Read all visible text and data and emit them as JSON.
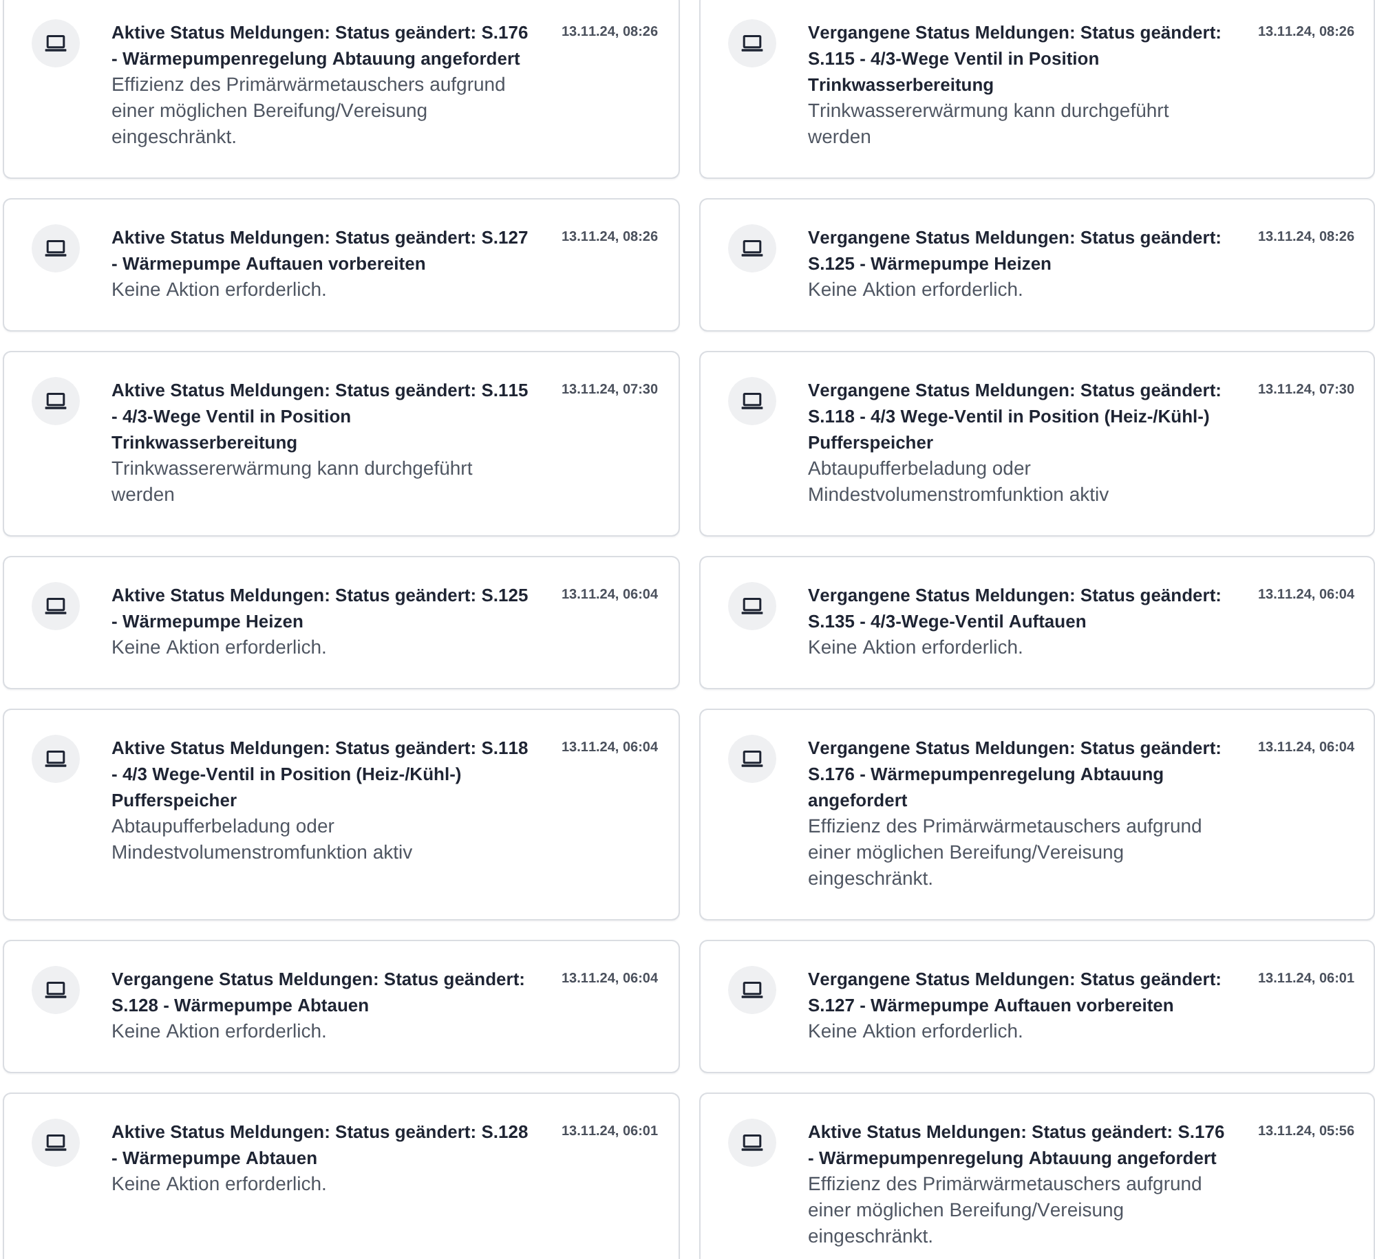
{
  "notifications": [
    {
      "title": "Aktive Status Meldungen: Status geändert: S.176 - Wärmepumpenregelung Abtauung angefordert",
      "timestamp": "13.11.24, 08:26",
      "message": "Effizienz des Primärwärmetauschers aufgrund einer möglichen Bereifung/Vereisung eingeschränkt."
    },
    {
      "title": "Vergangene Status Meldungen: Status geändert: S.115 - 4/3-Wege Ventil in Position Trinkwasserbereitung",
      "timestamp": "13.11.24, 08:26",
      "message": "Trinkwassererwärmung kann durchgeführt werden"
    },
    {
      "title": "Aktive Status Meldungen: Status geändert: S.127 - Wärmepumpe Auftauen vorbereiten",
      "timestamp": "13.11.24, 08:26",
      "message": "Keine Aktion erforderlich."
    },
    {
      "title": "Vergangene Status Meldungen: Status geändert: S.125 - Wärmepumpe Heizen",
      "timestamp": "13.11.24, 08:26",
      "message": "Keine Aktion erforderlich."
    },
    {
      "title": "Aktive Status Meldungen: Status geändert: S.115 - 4/3-Wege Ventil in Position Trinkwasserbereitung",
      "timestamp": "13.11.24, 07:30",
      "message": "Trinkwassererwärmung kann durchgeführt werden"
    },
    {
      "title": "Vergangene Status Meldungen: Status geändert: S.118 - 4/3 Wege-Ventil in Position (Heiz-/Kühl-) Pufferspeicher",
      "timestamp": "13.11.24, 07:30",
      "message": "Abtaupufferbeladung oder Mindestvolumenstromfunktion aktiv"
    },
    {
      "title": "Aktive Status Meldungen: Status geändert: S.125 - Wärmepumpe Heizen",
      "timestamp": "13.11.24, 06:04",
      "message": "Keine Aktion erforderlich."
    },
    {
      "title": "Vergangene Status Meldungen: Status geändert: S.135 - 4/3-Wege-Ventil Auftauen",
      "timestamp": "13.11.24, 06:04",
      "message": "Keine Aktion erforderlich."
    },
    {
      "title": "Aktive Status Meldungen: Status geändert: S.118 - 4/3 Wege-Ventil in Position (Heiz-/Kühl-) Pufferspeicher",
      "timestamp": "13.11.24, 06:04",
      "message": "Abtaupufferbeladung oder Mindestvolumenstromfunktion aktiv"
    },
    {
      "title": "Vergangene Status Meldungen: Status geändert: S.176 - Wärmepumpenregelung Abtauung angefordert",
      "timestamp": "13.11.24, 06:04",
      "message": "Effizienz des Primärwärmetauschers aufgrund einer möglichen Bereifung/Vereisung eingeschränkt."
    },
    {
      "title": "Vergangene Status Meldungen: Status geändert: S.128 - Wärmepumpe Abtauen",
      "timestamp": "13.11.24, 06:04",
      "message": "Keine Aktion erforderlich."
    },
    {
      "title": "Vergangene Status Meldungen: Status geändert: S.127 - Wärmepumpe Auftauen vorbereiten",
      "timestamp": "13.11.24, 06:01",
      "message": "Keine Aktion erforderlich."
    },
    {
      "title": "Aktive Status Meldungen: Status geändert: S.128 - Wärmepumpe Abtauen",
      "timestamp": "13.11.24, 06:01",
      "message": "Keine Aktion erforderlich."
    },
    {
      "title": "Aktive Status Meldungen: Status geändert: S.176 - Wärmepumpenregelung Abtauung angefordert",
      "timestamp": "13.11.24, 05:56",
      "message": "Effizienz des Primärwärmetauschers aufgrund einer möglichen Bereifung/Vereisung eingeschränkt."
    }
  ]
}
